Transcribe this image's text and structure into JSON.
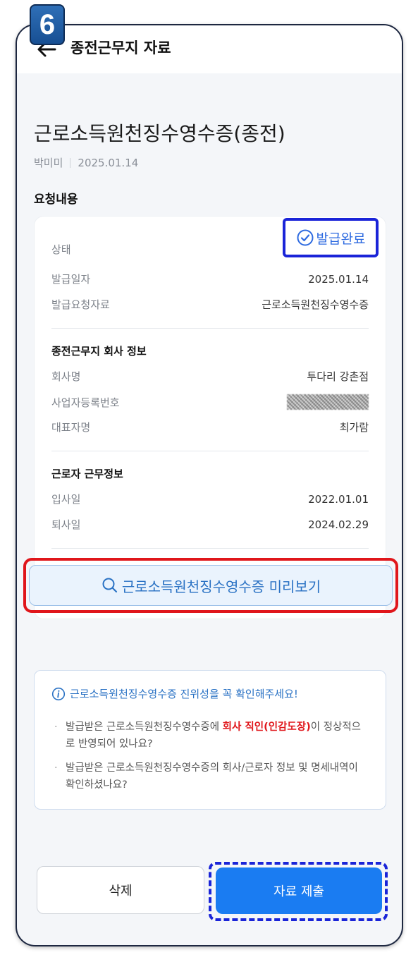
{
  "step_badge": "6",
  "header": {
    "title": "종전근무지 자료"
  },
  "document": {
    "title": "근로소득원천징수영수증(종전)",
    "name": "박미미",
    "date": "2025.01.14"
  },
  "request": {
    "section_title": "요청내용",
    "status_label": "상태",
    "status_value": "발급완료",
    "issue_date_label": "발급일자",
    "issue_date_value": "2025.01.14",
    "requested_doc_label": "발급요청자료",
    "requested_doc_value": "근로소득원천징수영수증"
  },
  "company": {
    "title": "종전근무지 회사 정보",
    "name_label": "회사명",
    "name_value": "투다리 강촌점",
    "bizno_label": "사업자등록번호",
    "ceo_label": "대표자명",
    "ceo_value": "최가람"
  },
  "work": {
    "title": "근로자 근무정보",
    "join_label": "입사일",
    "join_value": "2022.01.01",
    "leave_label": "퇴사일",
    "leave_value": "2024.02.29"
  },
  "preview_button": "근로소득원천징수영수증 미리보기",
  "notice": {
    "head": "근로소득원천징수영수증 진위성을 꼭 확인해주세요!",
    "b1_pre": "발급받은 근로소득원천징수영수증에 ",
    "b1_hl": "회사 직인(인감도장)",
    "b1_post": "이 정상적으로 반영되어 있나요?",
    "b2": "발급받은 근로소득원천징수영수증의 회사/근로자 정보 및 명세내역이 확인하셨나요?"
  },
  "actions": {
    "delete": "삭제",
    "submit": "자료 제출"
  },
  "colors": {
    "accent": "#1a7cf2",
    "highlight_red": "#e0161b",
    "annotation_blue": "#1a24d8"
  }
}
